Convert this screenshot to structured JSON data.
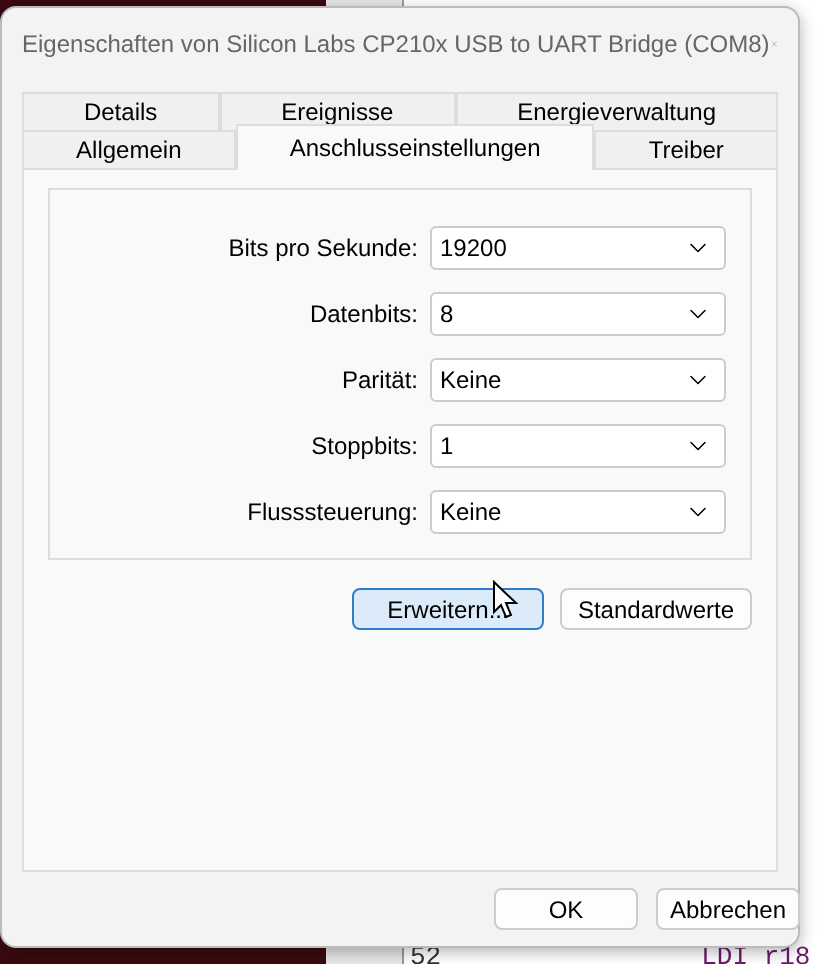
{
  "window": {
    "title": "Eigenschaften von Silicon Labs CP210x USB to UART Bridge (COM8)"
  },
  "tab_rows": [
    [
      {
        "label": "Details",
        "selected": false
      },
      {
        "label": "Ereignisse",
        "selected": false
      },
      {
        "label": "Energieverwaltung",
        "selected": false
      }
    ],
    [
      {
        "label": "Allgemein",
        "selected": false
      },
      {
        "label": "Anschlusseinstellungen",
        "selected": true
      },
      {
        "label": "Treiber",
        "selected": false
      }
    ]
  ],
  "settings": [
    {
      "label": "Bits pro Sekunde:",
      "value": "19200"
    },
    {
      "label": "Datenbits:",
      "value": "8"
    },
    {
      "label": "Parität:",
      "value": "Keine"
    },
    {
      "label": "Stoppbits:",
      "value": "1"
    },
    {
      "label": "Flusssteuerung:",
      "value": "Keine"
    }
  ],
  "panel_buttons": [
    {
      "label": "Erweitern...",
      "hovered": true
    },
    {
      "label": "Standardwerte",
      "hovered": false
    }
  ],
  "buttons": [
    "OK",
    "Abbrechen"
  ],
  "background_code": {
    "line_number": "52",
    "code": "LDI r18"
  }
}
